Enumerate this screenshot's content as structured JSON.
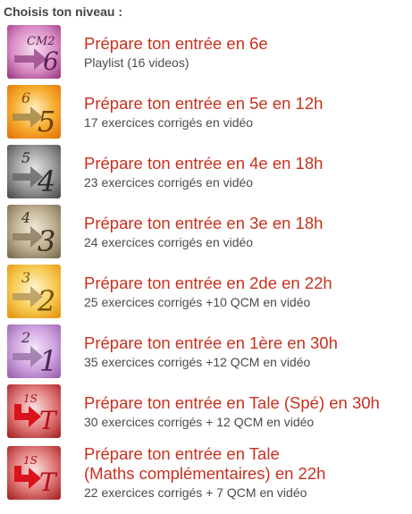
{
  "heading": "Choisis ton niveau :",
  "items": [
    {
      "title": "Prépare ton entrée en 6e",
      "subtitle": "Playlist (16 videos)",
      "icon": "cm2-to-6-icon",
      "from": "CM2",
      "to": "6",
      "tint": "#c96fb5"
    },
    {
      "title": "Prépare ton entrée en 5e en 12h",
      "subtitle": "17 exercices corrigés en vidéo",
      "icon": "6-to-5-icon",
      "from": "6",
      "to": "5",
      "tint": "#f29a12"
    },
    {
      "title": "Prépare ton entrée en 4e en 18h",
      "subtitle": "23 exercices corrigés en vidéo",
      "icon": "5-to-4-icon",
      "from": "5",
      "to": "4",
      "tint": "#7d7d7d"
    },
    {
      "title": "Prépare ton entrée en 3e en 18h",
      "subtitle": "24 exercices corrigés en vidéo",
      "icon": "4-to-3-icon",
      "from": "4",
      "to": "3",
      "tint": "#a89a7d"
    },
    {
      "title": "Prépare ton entrée en 2de en 22h",
      "subtitle": "25 exercices corrigés +10 QCM en vidéo",
      "icon": "3-to-2-icon",
      "from": "3",
      "to": "2",
      "tint": "#f4c13d"
    },
    {
      "title": "Prépare ton entrée en 1ère en 30h",
      "subtitle": "35 exercices corrigés +12 QCM en vidéo",
      "icon": "2-to-1-icon",
      "from": "2",
      "to": "1",
      "tint": "#c99ad6"
    },
    {
      "title": "Prépare ton entrée en Tale (Spé) en 30h",
      "subtitle": "30 exercices corrigés + 12 QCM en vidéo",
      "icon": "1s-to-t-icon",
      "from": "1S",
      "to": "T",
      "tint": "#c7393a"
    },
    {
      "title_line1": "Prépare ton entrée en Tale",
      "title_line2": "(Maths complémentaires) en 22h",
      "subtitle": "22 exercices corrigés + 7 QCM en vidéo",
      "icon": "1s-to-t-icon",
      "from": "1S",
      "to": "T",
      "tint": "#c7393a"
    }
  ]
}
